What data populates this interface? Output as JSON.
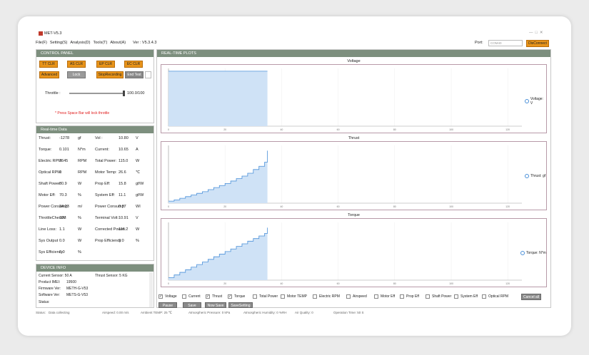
{
  "title": "MET-V5.3",
  "menu": [
    "File(F)",
    "Setting(S)",
    "Analysis(D)",
    "Tools(T)",
    "About(A)",
    "Ver : V5.3.4.3"
  ],
  "port": {
    "label": "Port:",
    "value": "COM40",
    "disconnect": "DisConnect"
  },
  "control_panel": {
    "title": "CONTROL PANEL",
    "buttons": [
      "TT CLR",
      "AS CLR",
      "EP CLR",
      "EC CLR"
    ],
    "row2": [
      "Advanced",
      "Lock",
      "StopRecording",
      "End Test"
    ],
    "throttle_label": "Throttle :",
    "throttle_value": "100.0/100",
    "throttle_level": 1.0,
    "note": "* Press Space Bar will lock throttle"
  },
  "realtime": {
    "title": "Real-time Data",
    "rows": [
      [
        "Thrust:",
        "-1278",
        "gf",
        "Vol :",
        "10.80",
        "V"
      ],
      [
        "Torque:",
        "0.101",
        "N*m",
        "Current:",
        "10.65",
        "A"
      ],
      [
        "Electric RPM:",
        "7645",
        "RPM",
        "Total Power:",
        "115.0",
        "W"
      ],
      [
        "Optical RPM:",
        "0",
        "RPM",
        "Motor Temp:",
        "26.6",
        "℃"
      ],
      [
        "Shaft Power:",
        "80.9",
        "W",
        "Prop Eff:",
        "15.8",
        "gf/W"
      ],
      [
        "Motor Eff:",
        "70.3",
        "%",
        "System Eff:",
        "11.1",
        "gf/W"
      ],
      [
        "Power Consump:",
        "34.23",
        "m/",
        "Power Consump:",
        "0.37",
        "WI"
      ],
      [
        "ThrottleCheckV:",
        "100",
        "%",
        "Terminal Volt:",
        "10.91",
        "V"
      ],
      [
        "Line Loss:",
        "1.1",
        "W",
        "Corrected Power:",
        "116.2",
        "W"
      ],
      [
        "Sys Output",
        "0.0",
        "W",
        "Prop Efficiency",
        "0.0",
        "%"
      ],
      [
        "Sys Efficiency",
        "0.0",
        "%",
        "",
        "",
        ""
      ]
    ]
  },
  "device": {
    "title": "DEVICE INFO",
    "current_sensor": "Current Sensor:  50  A",
    "thrust_sensor": "Thrust Sensor:  5  KG",
    "imei_label": "Product IMEI:",
    "imei": "19500",
    "fw_label": "Firmware Ver:",
    "fw": "METH-G-V53",
    "sw_label": "Software Ver:",
    "sw": "METS-G-V53",
    "status_label": "Status:"
  },
  "plots": {
    "title": "REAL-TIME PLOTS",
    "charts": [
      {
        "title": "Voltage",
        "legend": "Voltage: V",
        "color": "#4a90d9"
      },
      {
        "title": "Thrust",
        "legend": "Thrust: gf",
        "color": "#4a90d9"
      },
      {
        "title": "Torque",
        "legend": "Torque: N*m",
        "color": "#4a90d9"
      }
    ]
  },
  "checks": [
    [
      "Voltage",
      true
    ],
    [
      "Current",
      false
    ],
    [
      "Thrust",
      true
    ],
    [
      "Torque",
      true
    ],
    [
      "Total Power",
      false
    ],
    [
      "Motor TEMP",
      false
    ],
    [
      "Electric RPM",
      false
    ],
    [
      "Airspeed",
      false
    ],
    [
      "Motor Eff",
      false
    ],
    [
      "Prop Eff",
      false
    ],
    [
      "Shaft Power",
      false
    ],
    [
      "System Eff",
      false
    ],
    [
      "Optical RPM",
      false
    ]
  ],
  "cancel_all": "Cancel all",
  "actions": [
    "Pause",
    "Save",
    "Now Save",
    "SaveSetting"
  ],
  "status": {
    "status": "Status:",
    "status_val": "Data collecting",
    "airspeed": "Airspeed: 0.00  m/s",
    "ambient": "Ambient TEMP: 25  ℃",
    "pressure": "Atmospheric Pressure: 0  kPa",
    "humidity": "Atmospheric Humidity: 0  %RH",
    "air": "Air Quality:  0",
    "optime": "Operation Time: 50  S"
  },
  "chart_data": [
    {
      "type": "area",
      "title": "Voltage",
      "x": [
        0,
        35
      ],
      "y": [
        10.8,
        10.8
      ],
      "xticks": [
        "0",
        "20",
        "40",
        "60",
        "80",
        "100",
        "120"
      ]
    },
    {
      "type": "area",
      "title": "Thrust",
      "x": [
        0,
        2,
        4,
        6,
        8,
        10,
        12,
        14,
        16,
        18,
        20,
        22,
        24,
        26,
        28,
        30,
        32,
        34,
        35
      ],
      "y": [
        50,
        80,
        120,
        160,
        200,
        240,
        280,
        330,
        380,
        430,
        480,
        540,
        600,
        660,
        730,
        820,
        900,
        1000,
        1280
      ],
      "xticks": [
        "0",
        "20",
        "40",
        "60",
        "80",
        "100",
        "120"
      ]
    },
    {
      "type": "area",
      "title": "Torque",
      "x": [
        0,
        2,
        4,
        6,
        8,
        10,
        12,
        14,
        16,
        18,
        20,
        22,
        24,
        26,
        28,
        30,
        32,
        34,
        35
      ],
      "y": [
        0.005,
        0.01,
        0.015,
        0.02,
        0.025,
        0.03,
        0.035,
        0.04,
        0.045,
        0.05,
        0.055,
        0.06,
        0.065,
        0.07,
        0.075,
        0.08,
        0.085,
        0.09,
        0.101
      ],
      "xticks": [
        "0",
        "20",
        "40",
        "60",
        "80",
        "100",
        "120"
      ]
    }
  ]
}
